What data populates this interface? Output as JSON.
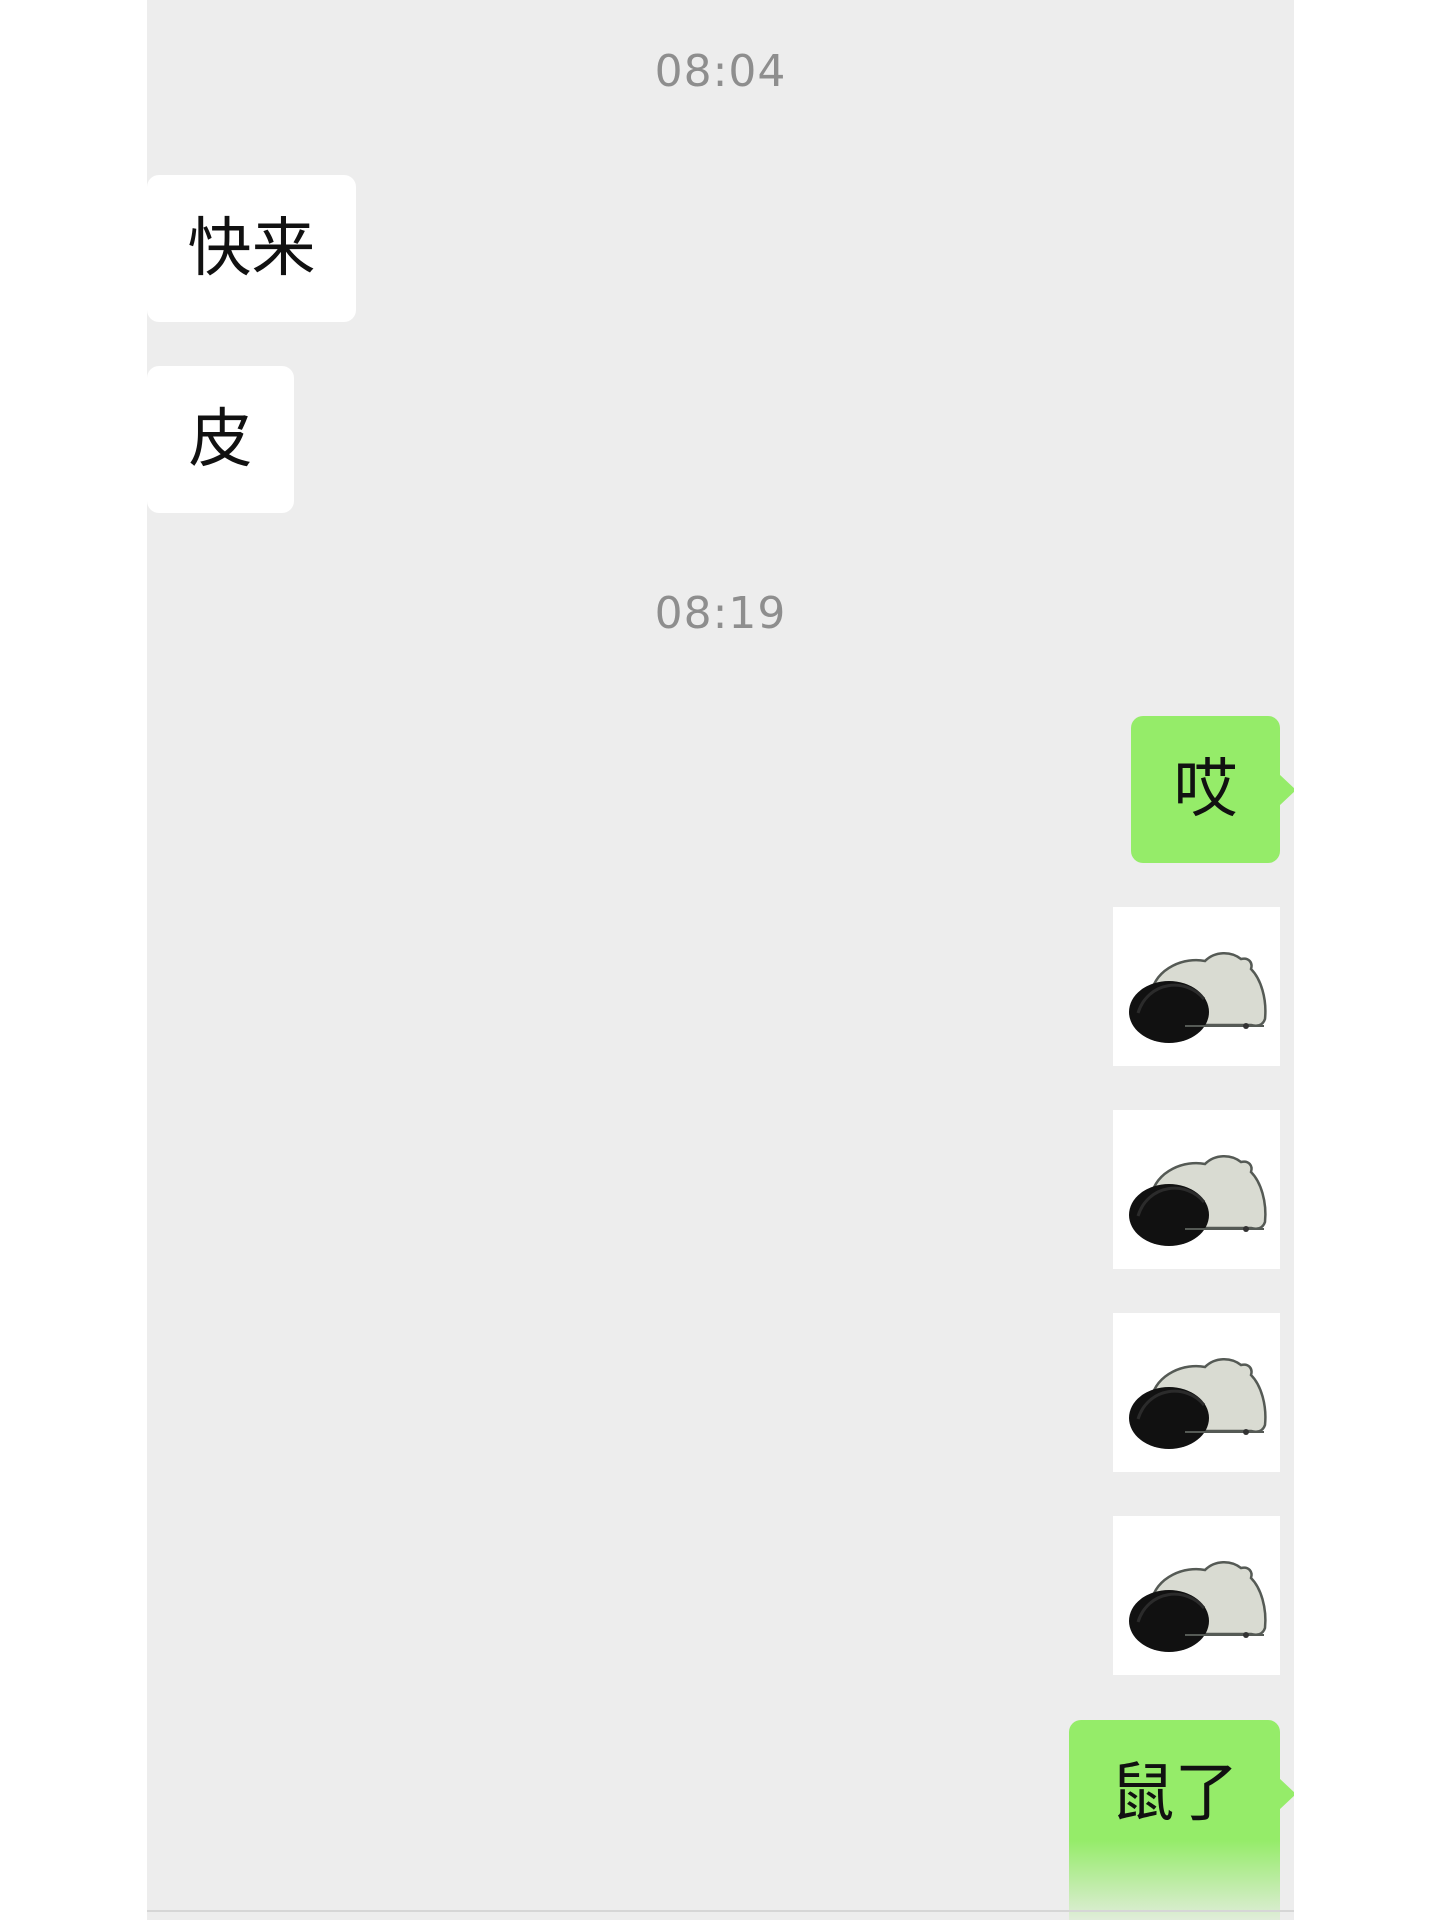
{
  "chat": {
    "timestamps": [
      "08:04",
      "08:19"
    ],
    "messages": [
      {
        "side": "received",
        "type": "text",
        "text": "快来"
      },
      {
        "side": "received",
        "type": "text",
        "text": "皮"
      },
      {
        "side": "sent",
        "type": "text",
        "text": "哎"
      },
      {
        "side": "sent",
        "type": "sticker",
        "sticker": "lying-creature-sticker"
      },
      {
        "side": "sent",
        "type": "sticker",
        "sticker": "lying-creature-sticker"
      },
      {
        "side": "sent",
        "type": "sticker",
        "sticker": "lying-creature-sticker"
      },
      {
        "side": "sent",
        "type": "sticker",
        "sticker": "lying-creature-sticker"
      },
      {
        "side": "sent",
        "type": "text",
        "text": "鼠了"
      }
    ]
  },
  "colors": {
    "background": "#ededed",
    "received_bubble": "#ffffff",
    "sent_bubble": "#95ec69",
    "timestamp_text": "#8e8e8e"
  }
}
